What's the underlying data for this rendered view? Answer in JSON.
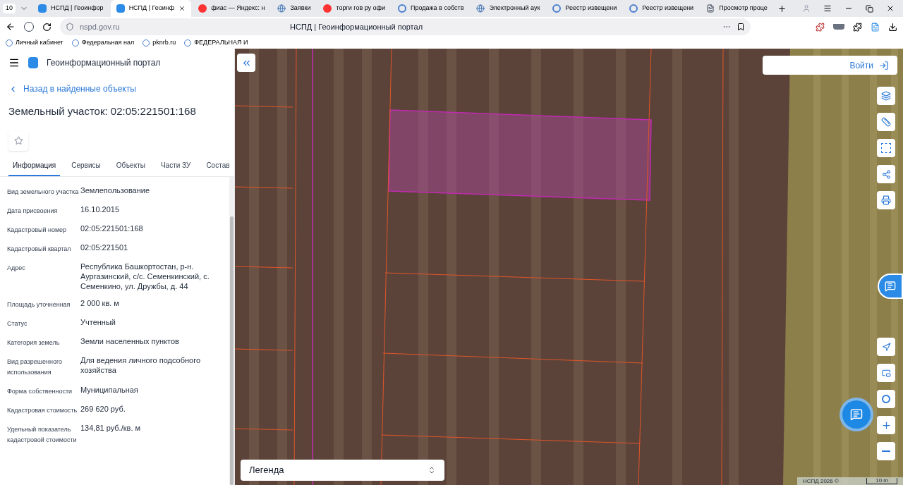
{
  "browser": {
    "tab_count": "10",
    "tabs": [
      {
        "title": "НСПД | Геоинфор",
        "selected": false
      },
      {
        "title": "НСПД | Геоинф",
        "selected": true
      },
      {
        "title": "фиас — Яндекс: н",
        "selected": false
      },
      {
        "title": "Заявки",
        "selected": false
      },
      {
        "title": "торги гов ру офи",
        "selected": false
      },
      {
        "title": "Продажа в собств",
        "selected": false
      },
      {
        "title": "Электронный аук",
        "selected": false
      },
      {
        "title": "Реестр извещени",
        "selected": false
      },
      {
        "title": "Реестр извещени",
        "selected": false
      },
      {
        "title": "Просмотр проце",
        "selected": false
      }
    ],
    "address": "nspd.gov.ru",
    "page_title": "НСПД | Геоинформационный портал",
    "bookmarks": [
      "Личный кабинет",
      "Федеральная нал",
      "pknrb.ru",
      "ФЕДЕРАЛЬНАЯ И"
    ]
  },
  "app": {
    "title": "Геоинформационный портал",
    "back_link": "Назад в найденные объекты",
    "object_title": "Земельный участок: 02:05:221501:168",
    "tabs": [
      {
        "label": "Информация",
        "selected": true
      },
      {
        "label": "Сервисы",
        "selected": false
      },
      {
        "label": "Объекты",
        "selected": false
      },
      {
        "label": "Части ЗУ",
        "selected": false
      },
      {
        "label": "Состав",
        "selected": false
      }
    ],
    "fields": [
      {
        "label": "Вид земельного участка",
        "value": "Землепользование"
      },
      {
        "label": "Дата присвоения",
        "value": "16.10.2015"
      },
      {
        "label": "Кадастровый номер",
        "value": "02:05:221501:168"
      },
      {
        "label": "Кадастровый квартал",
        "value": "02:05:221501"
      },
      {
        "label": "Адрес",
        "value": "Республика Башкортостан, р-н. Аургазинский, с/с. Семенкинский, с. Семенкино, ул. Дружбы, д. 44"
      },
      {
        "label": "Площадь уточненная",
        "value": "2 000 кв. м"
      },
      {
        "label": "Статус",
        "value": "Учтенный"
      },
      {
        "label": "Категория земель",
        "value": "Земли населенных пунктов"
      },
      {
        "label": "Вид разрешенного использования",
        "value": "Для ведения личного подсобного хозяйства"
      },
      {
        "label": "Форма собственности",
        "value": "Муниципальная"
      },
      {
        "label": "Кадастровая стоимость",
        "value": "269 620 руб."
      },
      {
        "label": "Удельный показатель кадастровой стоимости",
        "value": "134,81 руб./кв. м"
      }
    ]
  },
  "map": {
    "login": "Войти",
    "legend": "Легенда",
    "copyright": "НСПД 2026 ©",
    "scale": "10 m"
  }
}
